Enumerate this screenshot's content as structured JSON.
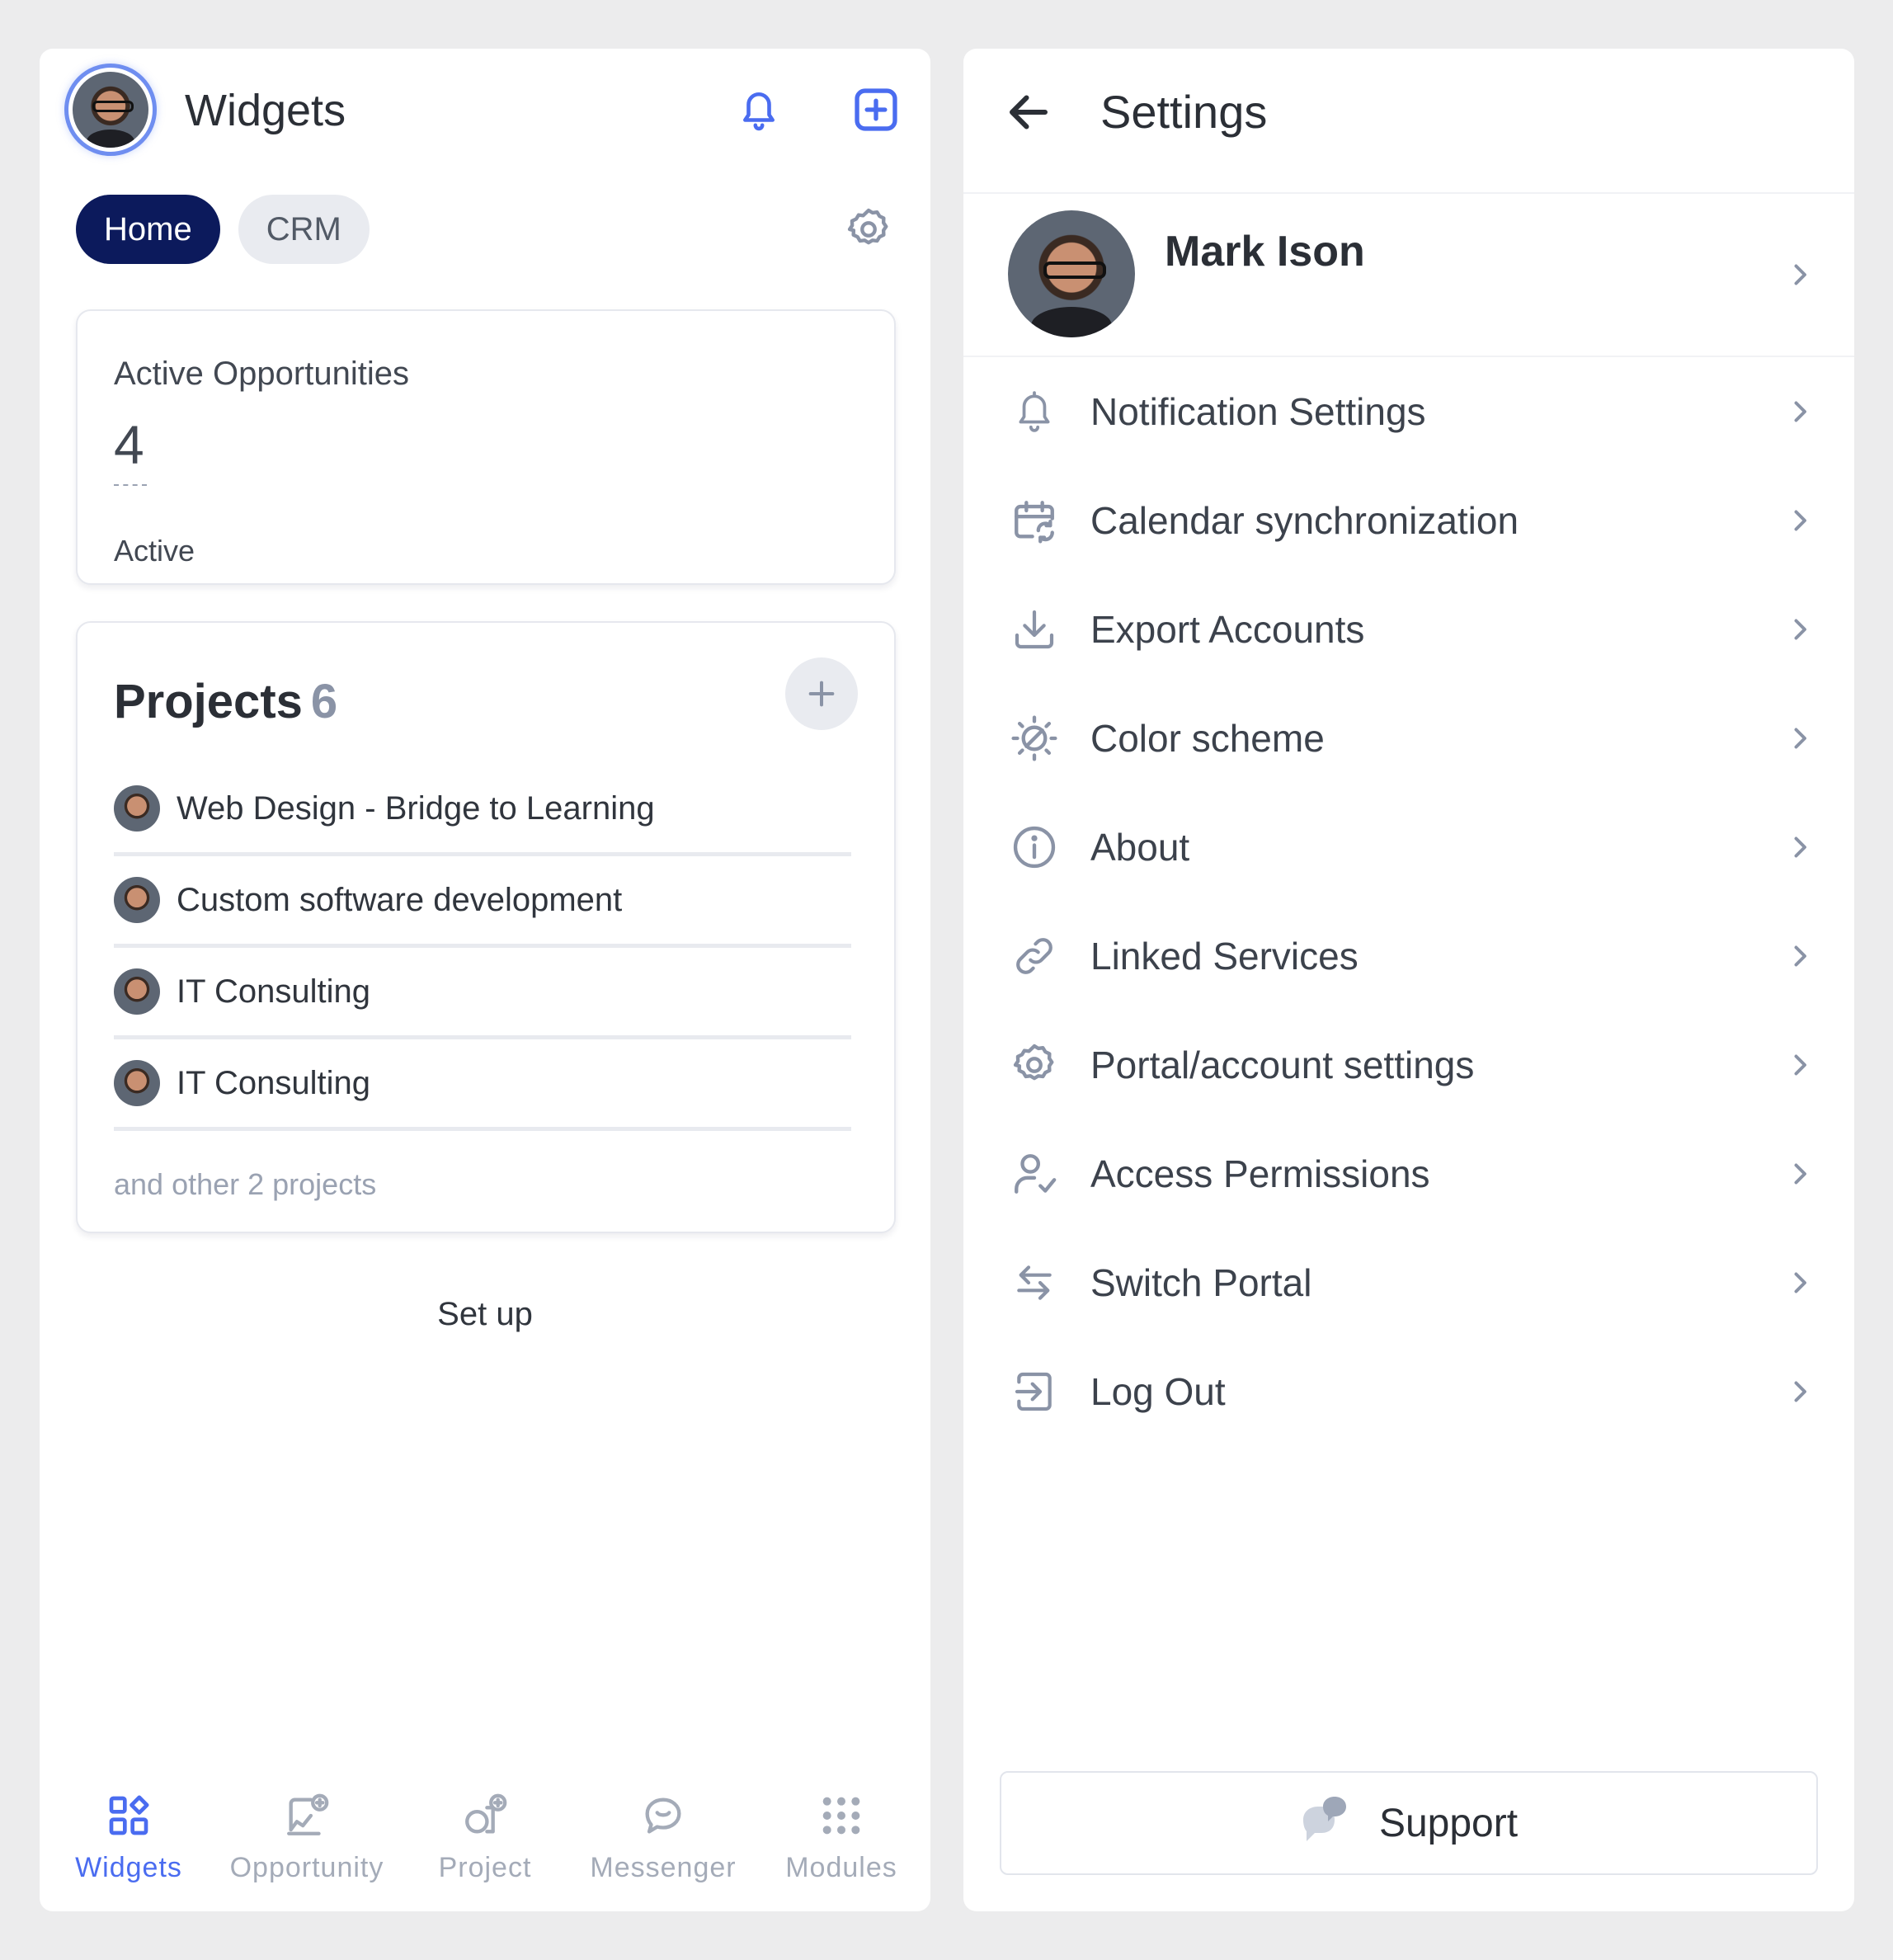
{
  "colors": {
    "accent": "#4a6cf0",
    "tab_active_bg": "#0c1a5c",
    "muted": "#9aa2b2",
    "page_bg": "#ececed"
  },
  "widgets_screen": {
    "title": "Widgets",
    "header_icons": [
      "bell-icon",
      "plus-square-icon"
    ],
    "tabs": [
      {
        "label": "Home",
        "active": true
      },
      {
        "label": "CRM",
        "active": false
      }
    ],
    "opportunities": {
      "title": "Active Opportunities",
      "value": "4",
      "label": "Active"
    },
    "projects": {
      "title": "Projects",
      "count": "6",
      "items": [
        {
          "name": "Web Design - Bridge to Learning"
        },
        {
          "name": "Custom software development"
        },
        {
          "name": "IT Consulting"
        },
        {
          "name": "IT Consulting"
        }
      ],
      "more": "and other 2 projects"
    },
    "setup_label": "Set up",
    "bottom_nav": [
      {
        "label": "Widgets",
        "icon": "widgets-icon",
        "active": true
      },
      {
        "label": "Opportunity",
        "icon": "opportunity-icon",
        "active": false
      },
      {
        "label": "Project",
        "icon": "project-icon",
        "active": false
      },
      {
        "label": "Messenger",
        "icon": "messenger-icon",
        "active": false
      },
      {
        "label": "Modules",
        "icon": "modules-icon",
        "active": false
      }
    ]
  },
  "settings_screen": {
    "title": "Settings",
    "profile": {
      "name": "Mark Ison"
    },
    "items": [
      {
        "label": "Notification Settings",
        "icon": "bell-icon"
      },
      {
        "label": "Calendar synchronization",
        "icon": "calendar-sync-icon"
      },
      {
        "label": "Export Accounts",
        "icon": "download-icon"
      },
      {
        "label": "Color scheme",
        "icon": "color-scheme-icon"
      },
      {
        "label": "About",
        "icon": "info-icon"
      },
      {
        "label": "Linked Services",
        "icon": "link-icon"
      },
      {
        "label": "Portal/account settings",
        "icon": "gear-icon"
      },
      {
        "label": "Access Permissions",
        "icon": "user-check-icon"
      },
      {
        "label": "Switch Portal",
        "icon": "switch-arrows-icon"
      },
      {
        "label": "Log Out",
        "icon": "logout-icon"
      }
    ],
    "support_label": "Support"
  }
}
